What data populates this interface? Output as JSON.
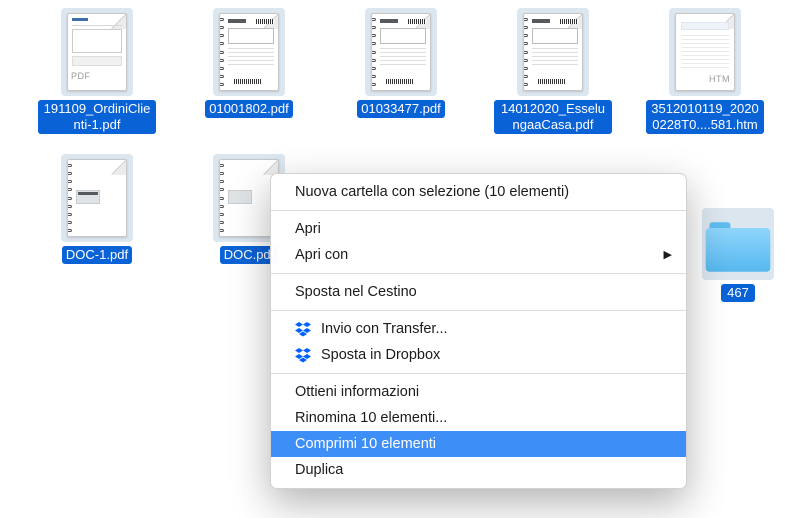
{
  "files_row1": [
    {
      "name": "191109_OrdiniClienti-1.pdf",
      "badge": "PDF",
      "variant": "invoice"
    },
    {
      "name": "01001802.pdf",
      "badge": "",
      "variant": "label"
    },
    {
      "name": "01033477.pdf",
      "badge": "",
      "variant": "label"
    },
    {
      "name": "14012020_EsselungaaCasa.pdf",
      "badge": "",
      "variant": "label"
    },
    {
      "name": "3512010119_20200228T0....581.htm",
      "badge": "HTM",
      "variant": "htm"
    }
  ],
  "files_row2": [
    {
      "name": "DOC-1.pdf",
      "badge": "",
      "variant": "doc"
    },
    {
      "name": "DOC.pdf",
      "badge": "",
      "variant": "doc"
    }
  ],
  "peek_label": "467",
  "menu": {
    "new_folder": "Nuova cartella con selezione (10 elementi)",
    "open": "Apri",
    "open_with": "Apri con",
    "trash": "Sposta nel Cestino",
    "transfer": "Invio con Transfer...",
    "dropbox": "Sposta in Dropbox",
    "info": "Ottieni informazioni",
    "rename": "Rinomina 10 elementi...",
    "compress": "Comprimi 10 elementi",
    "duplicate": "Duplica"
  }
}
